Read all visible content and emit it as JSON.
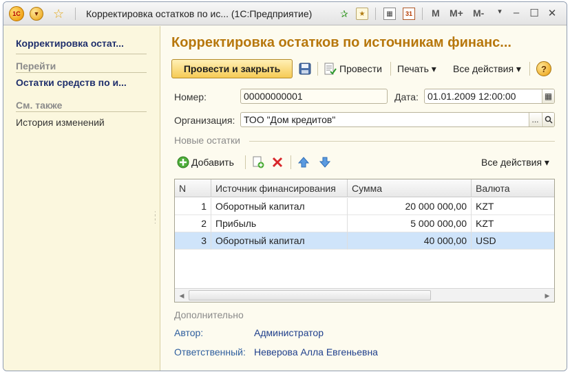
{
  "window": {
    "title": "Корректировка остатков по ис... (1С:Предприятие)",
    "logo_text": "1С",
    "mbar": [
      "M",
      "M+",
      "M-"
    ]
  },
  "left_panel": {
    "active": "Корректировка остат...",
    "goto_header": "Перейти",
    "goto_items": [
      "Остатки средств по и..."
    ],
    "see_also_header": "См. также",
    "see_also_items": [
      "История изменений"
    ]
  },
  "form": {
    "title": "Корректировка остатков по источникам финанс...",
    "toolbar": {
      "post_close": "Провести и закрыть",
      "post": "Провести",
      "print": "Печать ▾",
      "all_actions": "Все действия ▾",
      "help": "?"
    },
    "number_label": "Номер:",
    "number_value": "00000000001",
    "date_label": "Дата:",
    "date_value": "01.01.2009 12:00:00",
    "org_label": "Организация:",
    "org_value": "ТОО \"Дом кредитов\"",
    "org_select_btn": "...",
    "new_balances_group": "Новые остатки",
    "table_toolbar": {
      "add": "Добавить",
      "all_actions": "Все действия ▾"
    },
    "table": {
      "columns": [
        "N",
        "Источник финансирования",
        "Сумма",
        "Валюта"
      ],
      "rows": [
        {
          "n": "1",
          "source": "Оборотный капитал",
          "sum": "20 000 000,00",
          "currency": "KZT"
        },
        {
          "n": "2",
          "source": "Прибыль",
          "sum": "5 000 000,00",
          "currency": "KZT"
        },
        {
          "n": "3",
          "source": "Оборотный капитал",
          "sum": "40 000,00",
          "currency": "USD"
        }
      ],
      "selected_row": 3
    },
    "additional_group": "Дополнительно",
    "author_label": "Автор:",
    "author_value": "Администратор",
    "responsible_label": "Ответственный:",
    "responsible_value": "Неверова Алла Евгеньевна"
  },
  "colors": {
    "title_accent": "#b7770c",
    "link": "#1f3f8c",
    "selection": "#cfe4fa"
  }
}
